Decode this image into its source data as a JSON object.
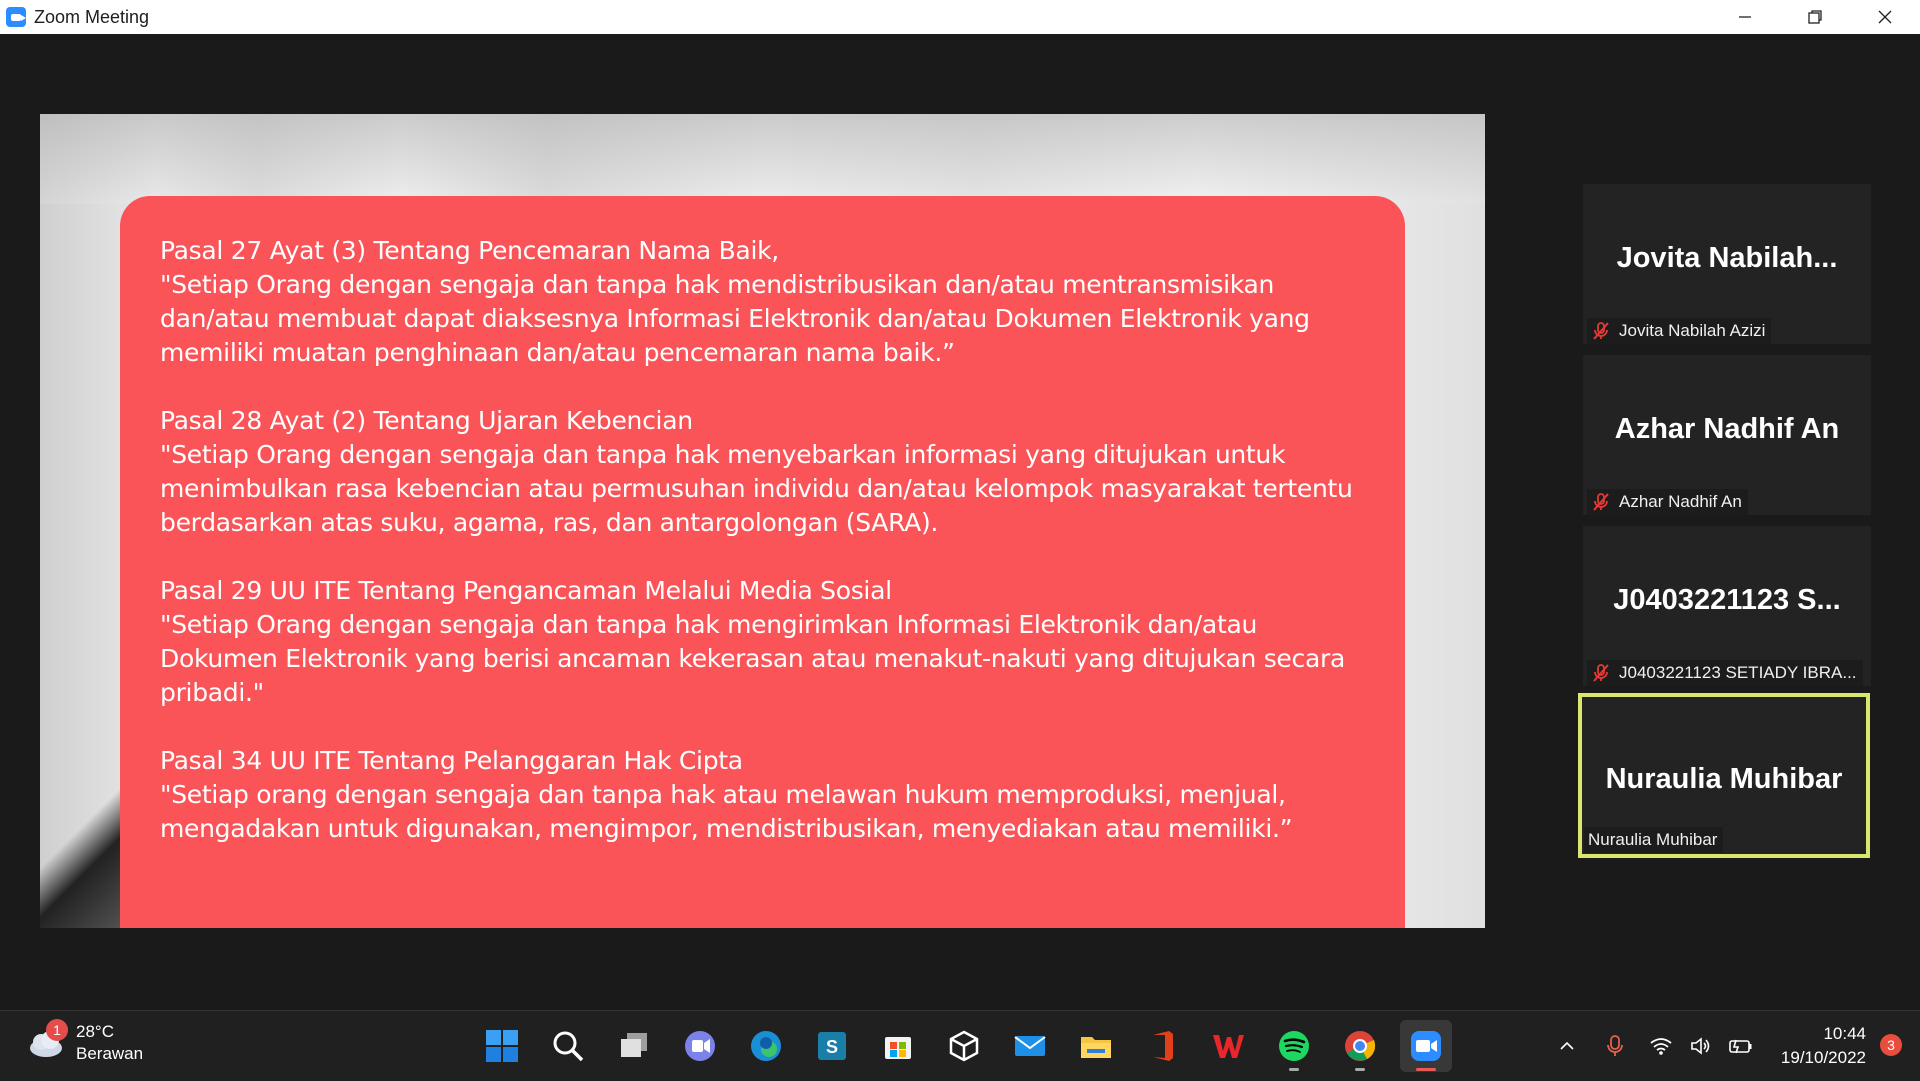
{
  "window": {
    "title": "Zoom Meeting",
    "controls": {
      "minimize": "─",
      "restore": "❐",
      "close": "✕"
    }
  },
  "slide": {
    "card_color": "#fb5458",
    "paragraphs": [
      {
        "heading": "Pasal 27 Ayat (3) Tentang Pencemaran Nama Baik,",
        "body": "\"Setiap Orang dengan sengaja dan tanpa hak mendistribusikan dan/atau mentransmisikan dan/atau membuat dapat diaksesnya Informasi Elektronik dan/atau Dokumen Elektronik yang memiliki muatan penghinaan dan/atau pencemaran nama baik.”"
      },
      {
        "heading": "Pasal 28 Ayat (2) Tentang Ujaran Kebencian",
        "body": "\"Setiap Orang dengan sengaja dan tanpa hak menyebarkan informasi yang ditujukan untuk menimbulkan rasa kebencian atau permusuhan individu dan/atau kelompok masyarakat tertentu berdasarkan atas suku, agama, ras, dan antargolongan (SARA)."
      },
      {
        "heading": "Pasal 29 UU ITE Tentang Pengancaman Melalui Media Sosial",
        "body": "\"Setiap Orang dengan sengaja dan tanpa hak mengirimkan Informasi Elektronik dan/atau Dokumen Elektronik yang berisi ancaman kekerasan atau menakut-nakuti yang ditujukan secara pribadi.\""
      },
      {
        "heading": "Pasal 34 UU ITE Tentang Pelanggaran Hak Cipta",
        "body": "\"Setiap orang dengan sengaja dan tanpa hak atau melawan hukum memproduksi, menjual, mengadakan untuk digunakan, mengimpor, mendistribusikan, menyediakan atau memiliki.”"
      }
    ]
  },
  "participants": [
    {
      "display_name": "Jovita  Nabilah...",
      "label": "Jovita Nabilah Azizi",
      "muted": true,
      "active": false
    },
    {
      "display_name": "Azhar Nadhif An",
      "label": "Azhar Nadhif An",
      "muted": true,
      "active": false
    },
    {
      "display_name": "J0403221123  S...",
      "label": "J0403221123 SETIADY IBRA...",
      "muted": true,
      "active": false
    },
    {
      "display_name": "Nuraulia Muhibar",
      "label": "Nuraulia Muhibar",
      "muted": false,
      "active": true
    }
  ],
  "taskbar": {
    "weather": {
      "temp": "28°C",
      "condition": "Berawan",
      "badge": "1"
    },
    "apps": [
      "windows-start",
      "search",
      "task-view",
      "teams-chat",
      "edge",
      "sway",
      "microsoft-store",
      "app-cube",
      "mail",
      "file-explorer",
      "office",
      "wps-office",
      "spotify",
      "chrome",
      "zoom"
    ],
    "clock": {
      "time": "10:44",
      "date": "19/10/2022"
    },
    "notification_count": "3",
    "tray_chevron": "^"
  },
  "colors": {
    "active_speaker_border": "#d9e86c",
    "mute_red": "#e53935"
  }
}
